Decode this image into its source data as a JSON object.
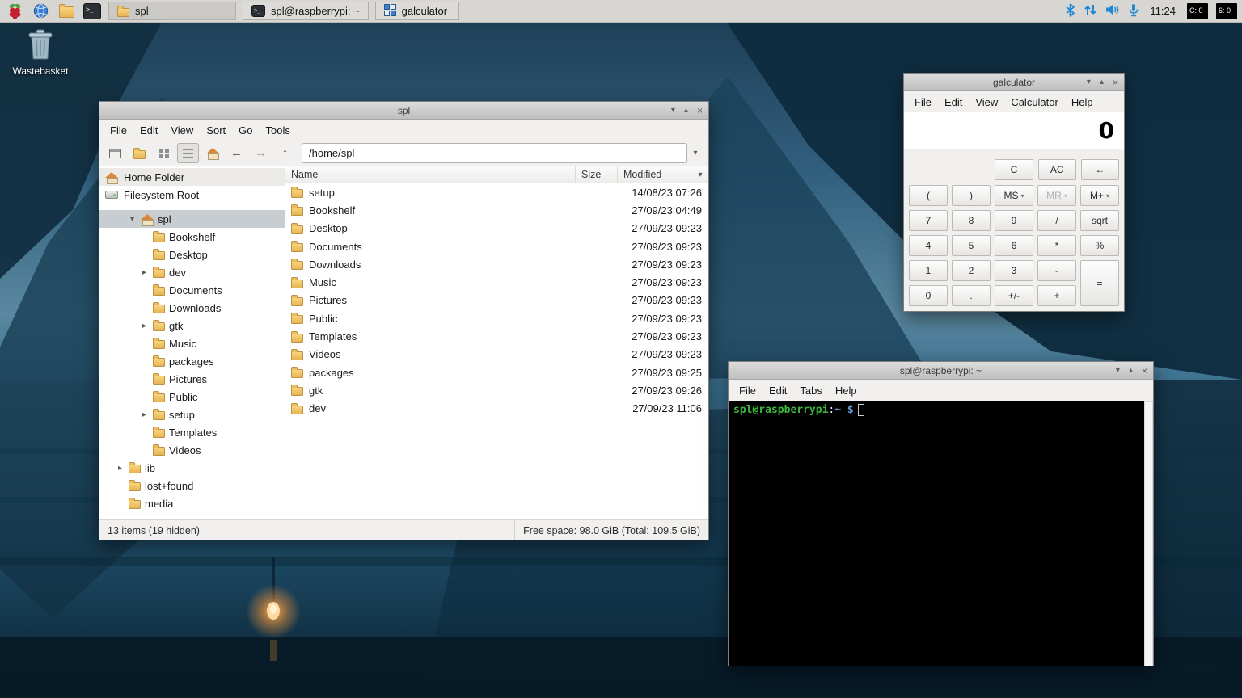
{
  "icons": {
    "back": "←",
    "forward": "→",
    "up": "↑",
    "combo": "▾",
    "sort": "▾",
    "dropdown": "▾",
    "collapse": "▾",
    "expand": "▸"
  },
  "window_controls": {
    "minimize": "▾",
    "maximize": "▴",
    "close": "×"
  },
  "taskbar": {
    "window_buttons": [
      {
        "label": "spl",
        "icon": "folder"
      },
      {
        "label": "spl@raspberrypi: ~",
        "icon": "terminal"
      },
      {
        "label": "galculator",
        "icon": "calculator"
      }
    ],
    "tray": {
      "clock": "11:24",
      "monitors": [
        {
          "label": "C:",
          "value": "0"
        },
        {
          "label": "6:",
          "value": "0"
        }
      ]
    }
  },
  "desktop": {
    "wastebasket": "Wastebasket"
  },
  "file_manager": {
    "title": "spl",
    "menu": [
      "File",
      "Edit",
      "View",
      "Sort",
      "Go",
      "Tools"
    ],
    "path": "/home/spl",
    "places": [
      {
        "label": "Home Folder"
      },
      {
        "label": "Filesystem Root"
      }
    ],
    "tree": [
      {
        "label": "spl",
        "level": 1,
        "expander": "open",
        "selected": true,
        "home": true
      },
      {
        "label": "Bookshelf",
        "level": 2
      },
      {
        "label": "Desktop",
        "level": 2
      },
      {
        "label": "dev",
        "level": 2,
        "expander": "closed"
      },
      {
        "label": "Documents",
        "level": 2
      },
      {
        "label": "Downloads",
        "level": 2
      },
      {
        "label": "gtk",
        "level": 2,
        "expander": "closed"
      },
      {
        "label": "Music",
        "level": 2
      },
      {
        "label": "packages",
        "level": 2
      },
      {
        "label": "Pictures",
        "level": 2
      },
      {
        "label": "Public",
        "level": 2
      },
      {
        "label": "setup",
        "level": 2,
        "expander": "closed"
      },
      {
        "label": "Templates",
        "level": 2
      },
      {
        "label": "Videos",
        "level": 2
      },
      {
        "label": "lib",
        "level": 0,
        "expander": "closed"
      },
      {
        "label": "lost+found",
        "level": 0
      },
      {
        "label": "media",
        "level": 0
      }
    ],
    "columns": [
      "Name",
      "Size",
      "Modified"
    ],
    "rows": [
      {
        "name": "setup",
        "size": "",
        "modified": "14/08/23 07:26"
      },
      {
        "name": "Bookshelf",
        "size": "",
        "modified": "27/09/23 04:49"
      },
      {
        "name": "Desktop",
        "size": "",
        "modified": "27/09/23 09:23"
      },
      {
        "name": "Documents",
        "size": "",
        "modified": "27/09/23 09:23"
      },
      {
        "name": "Downloads",
        "size": "",
        "modified": "27/09/23 09:23"
      },
      {
        "name": "Music",
        "size": "",
        "modified": "27/09/23 09:23"
      },
      {
        "name": "Pictures",
        "size": "",
        "modified": "27/09/23 09:23"
      },
      {
        "name": "Public",
        "size": "",
        "modified": "27/09/23 09:23"
      },
      {
        "name": "Templates",
        "size": "",
        "modified": "27/09/23 09:23"
      },
      {
        "name": "Videos",
        "size": "",
        "modified": "27/09/23 09:23"
      },
      {
        "name": "packages",
        "size": "",
        "modified": "27/09/23 09:25"
      },
      {
        "name": "gtk",
        "size": "",
        "modified": "27/09/23 09:26"
      },
      {
        "name": "dev",
        "size": "",
        "modified": "27/09/23 11:06"
      }
    ],
    "status_left": "13 items (19 hidden)",
    "status_right": "Free space: 98.0 GiB (Total: 109.5 GiB)"
  },
  "calculator": {
    "title": "galculator",
    "menu": [
      "File",
      "Edit",
      "View",
      "Calculator",
      "Help"
    ],
    "display": "0",
    "top_buttons": [
      "C",
      "AC",
      "←"
    ],
    "buttons": [
      {
        "label": "("
      },
      {
        "label": ")"
      },
      {
        "label": "MS",
        "dropdown": true
      },
      {
        "label": "MR",
        "dropdown": true,
        "disabled": true
      },
      {
        "label": "M+",
        "dropdown": true
      },
      {
        "label": "7"
      },
      {
        "label": "8"
      },
      {
        "label": "9"
      },
      {
        "label": "/"
      },
      {
        "label": "sqrt"
      },
      {
        "label": "4"
      },
      {
        "label": "5"
      },
      {
        "label": "6"
      },
      {
        "label": "*"
      },
      {
        "label": "%"
      },
      {
        "label": "1"
      },
      {
        "label": "2"
      },
      {
        "label": "3"
      },
      {
        "label": "-"
      },
      {
        "label": "=",
        "span": 2
      },
      {
        "label": "0"
      },
      {
        "label": "."
      },
      {
        "label": "+/-"
      },
      {
        "label": "+"
      }
    ]
  },
  "terminal": {
    "title": "spl@raspberrypi: ~",
    "menu": [
      "File",
      "Edit",
      "Tabs",
      "Help"
    ],
    "prompt": {
      "user": "spl@raspberrypi",
      "separator": ":",
      "path": "~",
      "dollar": "$"
    }
  }
}
